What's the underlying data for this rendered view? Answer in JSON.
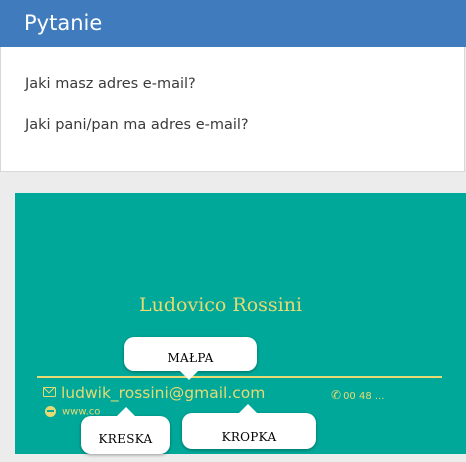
{
  "header": {
    "title": "Pytanie",
    "background": "#3f7bbd"
  },
  "question": {
    "lines": [
      "Jaki masz adres e-mail?",
      "Jaki pani/pan ma adres e-mail?"
    ]
  },
  "card": {
    "background": "#00a899",
    "accent": "#e7da73",
    "name": "Ludovico Rossini",
    "email": "ludwik_rossini@gmail.com",
    "phone": "00 48 ...",
    "website": "www.co",
    "icons": [
      "envelope-icon",
      "phone-icon",
      "globe-icon"
    ]
  },
  "callouts": {
    "at_sign": "MAŁPA",
    "underscore": "KRESKA",
    "dot": "KROPKA"
  }
}
